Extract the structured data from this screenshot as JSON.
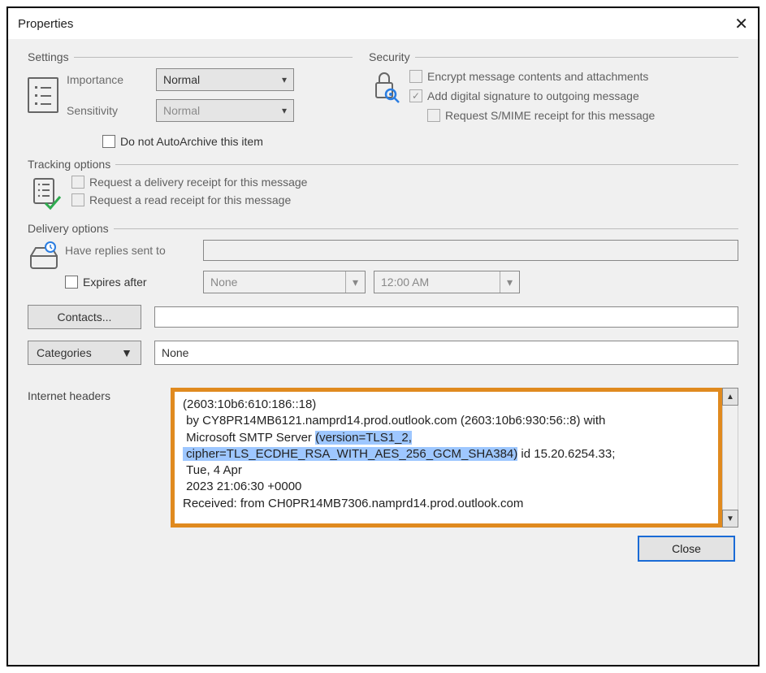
{
  "window": {
    "title": "Properties"
  },
  "settings": {
    "legend": "Settings",
    "importance_label": "Importance",
    "importance_value": "Normal",
    "sensitivity_label": "Sensitivity",
    "sensitivity_value": "Normal",
    "autoarchive_label": "Do not AutoArchive this item"
  },
  "security": {
    "legend": "Security",
    "encrypt_label": "Encrypt message contents and attachments",
    "sign_label": "Add digital signature to outgoing message",
    "smime_label": "Request S/MIME receipt for this message"
  },
  "tracking": {
    "legend": "Tracking options",
    "delivery_receipt_label": "Request a delivery receipt for this message",
    "read_receipt_label": "Request a read receipt for this message"
  },
  "delivery": {
    "legend": "Delivery options",
    "replies_label": "Have replies sent to",
    "expires_label": "Expires after",
    "expires_date": "None",
    "expires_time": "12:00 AM"
  },
  "buttons": {
    "contacts": "Contacts...",
    "categories": "Categories",
    "categories_value": "None",
    "close": "Close"
  },
  "headers": {
    "label": "Internet headers",
    "pre": "(2603:10b6:610:186::18)\n by CY8PR14MB6121.namprd14.prod.outlook.com (2603:10b6:930:56::8) with\n Microsoft SMTP Server ",
    "highlight": "(version=TLS1_2,\n cipher=TLS_ECDHE_RSA_WITH_AES_256_GCM_SHA384)",
    "post": " id 15.20.6254.33;\n Tue, 4 Apr\n 2023 21:06:30 +0000\nReceived: from CH0PR14MB7306.namprd14.prod.outlook.com"
  }
}
